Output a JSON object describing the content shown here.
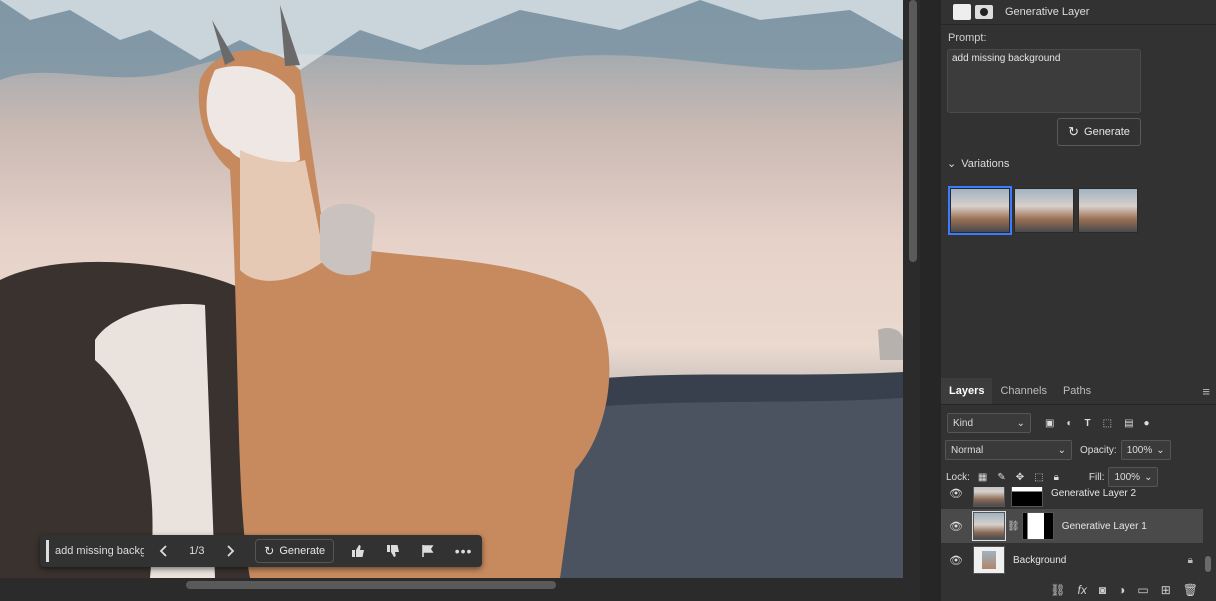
{
  "canvas": {
    "context_bar": {
      "prompt_value": "add missing backgr",
      "page_indicator": "1/3",
      "generate_label": "Generate"
    }
  },
  "properties_panel": {
    "layer_title": "Generative Layer",
    "prompt_label": "Prompt:",
    "prompt_value": "add missing background",
    "generate_label": "Generate",
    "variations_label": "Variations",
    "variations_count": 3,
    "selected_variation": 1
  },
  "layers_panel": {
    "tabs": [
      {
        "label": "Layers",
        "active": true
      },
      {
        "label": "Channels",
        "active": false
      },
      {
        "label": "Paths",
        "active": false
      }
    ],
    "filter_kind": "Kind",
    "blend_mode": "Normal",
    "opacity_label": "Opacity:",
    "opacity_value": "100%",
    "lock_label": "Lock:",
    "fill_label": "Fill:",
    "fill_value": "100%",
    "layers": [
      {
        "name": "Generative Layer 2",
        "selected": false
      },
      {
        "name": "Generative Layer 1",
        "selected": true
      },
      {
        "name": "Background",
        "selected": false
      }
    ]
  },
  "colors": {
    "accent": "#3b7cff",
    "panel_bg": "#323232",
    "selected_row": "#4a4a4a"
  }
}
